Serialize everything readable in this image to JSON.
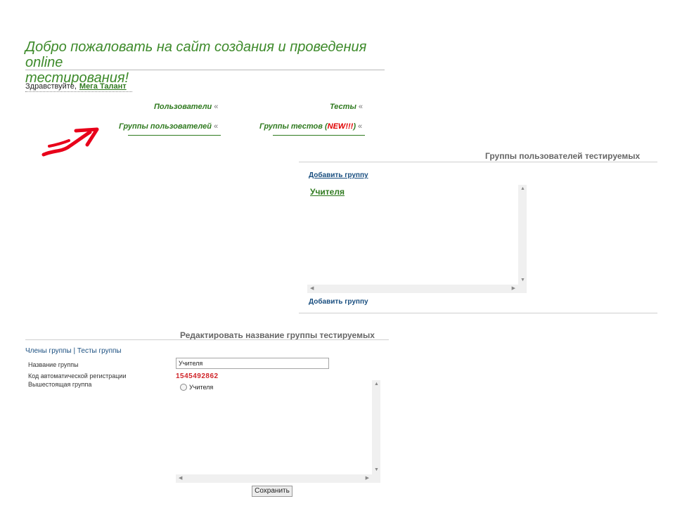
{
  "header": {
    "welcome_line1": "Добро пожаловать на сайт создания и проведения online",
    "welcome_line2": "тестирования!",
    "greeting": "Здравствуйте,",
    "user_name": "Мега Талант"
  },
  "menu": {
    "users": "Пользователи",
    "tests": "Тесты",
    "user_groups": "Группы пользователей",
    "test_groups_prefix": "Группы тестов (",
    "test_groups_new": "NEW!!!",
    "test_groups_suffix": ")",
    "arrows": "«"
  },
  "groups_panel": {
    "title": "Группы пользователей тестируемых",
    "add_group_top": "Добавить группу",
    "add_group_bottom": "Добавить группу",
    "items": [
      "Учителя"
    ]
  },
  "edit_form": {
    "title": "Редактировать название группы тестируемых",
    "tab_members": "Члены группы",
    "tab_separator": "|",
    "tab_tests": "Тесты группы",
    "label_name": "Название группы",
    "label_code": "Код автоматической регистрации",
    "label_parent": "Вышестоящая группа",
    "name_value": "Учителя",
    "registration_code": "1545492862",
    "parent_options": [
      "Учителя"
    ],
    "save_label": "Сохранить"
  },
  "colors": {
    "accent_green": "#2f7a1f",
    "link_blue": "#1a4f80",
    "highlight_red": "#d0262b",
    "annotation_arrow": "#e8001a"
  },
  "icons": [
    "red-arrow-annotation",
    "scroll-up-icon",
    "scroll-down-icon",
    "scroll-left-icon",
    "scroll-right-icon",
    "radio-icon"
  ]
}
